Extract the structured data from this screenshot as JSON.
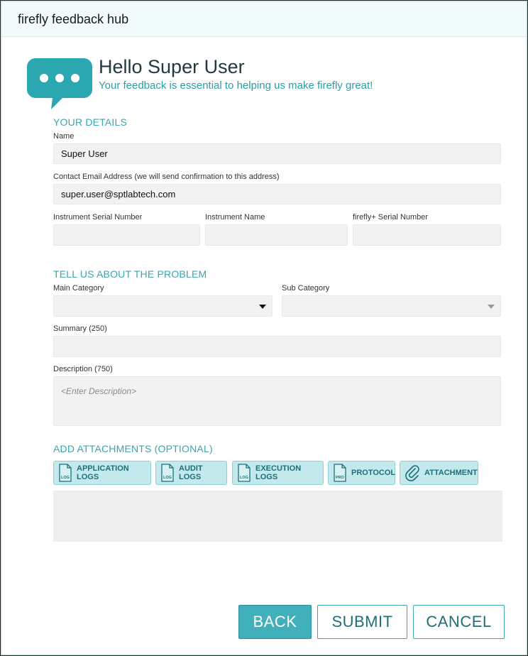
{
  "window": {
    "title": "firefly feedback hub"
  },
  "header": {
    "greeting": "Hello Super User",
    "tagline": "Your feedback is essential to helping us make firefly great!"
  },
  "details": {
    "heading": "YOUR DETAILS",
    "name_label": "Name",
    "name_value": "Super User",
    "email_label": "Contact Email Address (we will send confirmation to this address)",
    "email_value": "super.user@sptlabtech.com",
    "serial_label": "Instrument Serial Number",
    "serial_value": "",
    "instrument_name_label": "Instrument Name",
    "instrument_name_value": "",
    "firefly_serial_label": "firefly+ Serial Number",
    "firefly_serial_value": ""
  },
  "problem": {
    "heading": "TELL US ABOUT THE PROBLEM",
    "main_category_label": "Main Category",
    "main_category_value": "",
    "sub_category_label": "Sub Category",
    "sub_category_value": "",
    "summary_label": "Summary (250)",
    "summary_value": "",
    "description_label": "Description (750)",
    "description_placeholder": "<Enter Description>"
  },
  "attachments": {
    "heading": "ADD ATTACHMENTS (OPTIONAL)",
    "buttons": [
      {
        "label": "APPLICATION LOGS",
        "icon": "log-file-icon",
        "badge": "LOG"
      },
      {
        "label": "AUDIT LOGS",
        "icon": "log-file-icon",
        "badge": "LOG"
      },
      {
        "label": "EXECUTION LOGS",
        "icon": "log-file-icon",
        "badge": "LOG"
      },
      {
        "label": "PROTOCOL",
        "icon": "protocol-file-icon",
        "badge": "PRO"
      },
      {
        "label": "ATTACHMENT",
        "icon": "paperclip-icon"
      }
    ]
  },
  "footer": {
    "back_label": "BACK",
    "submit_label": "SUBMIT",
    "cancel_label": "CANCEL"
  },
  "colors": {
    "accent": "#3ba4ae",
    "button_fill": "#c3e9ec",
    "primary_button": "#42b0ba"
  }
}
